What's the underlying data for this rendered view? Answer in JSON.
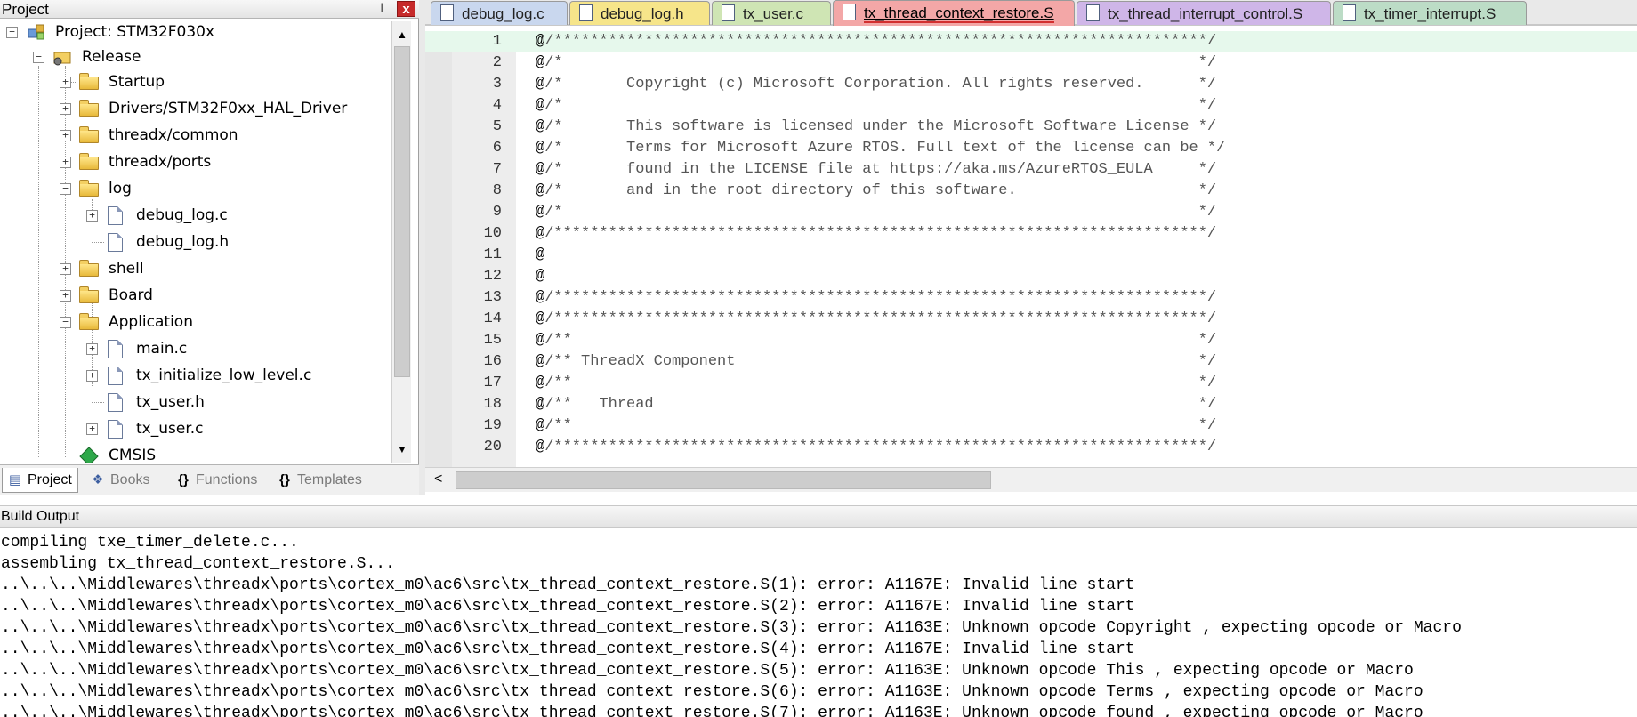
{
  "project_panel": {
    "title": "Project",
    "pin_icon": "pin-icon",
    "close_label": "x",
    "tree": [
      {
        "label": "Project: STM32F030x",
        "icon": "project-icon",
        "expander": "−"
      },
      {
        "label": "Release",
        "icon": "target-icon",
        "expander": "−"
      },
      {
        "label": "Startup",
        "icon": "folder-icon",
        "expander": "+"
      },
      {
        "label": "Drivers/STM32F0xx_HAL_Driver",
        "icon": "folder-icon",
        "expander": "+"
      },
      {
        "label": "threadx/common",
        "icon": "folder-icon",
        "expander": "+"
      },
      {
        "label": "threadx/ports",
        "icon": "folder-icon",
        "expander": "+"
      },
      {
        "label": "log",
        "icon": "open-folder-icon",
        "expander": "−"
      },
      {
        "label": "debug_log.c",
        "icon": "file-icon",
        "expander": "+"
      },
      {
        "label": "debug_log.h",
        "icon": "file-icon",
        "expander": ""
      },
      {
        "label": "shell",
        "icon": "folder-icon",
        "expander": "+"
      },
      {
        "label": "Board",
        "icon": "folder-icon",
        "expander": "+"
      },
      {
        "label": "Application",
        "icon": "open-folder-icon",
        "expander": "−"
      },
      {
        "label": "main.c",
        "icon": "file-icon",
        "expander": "+"
      },
      {
        "label": "tx_initialize_low_level.c",
        "icon": "file-icon",
        "expander": "+"
      },
      {
        "label": "tx_user.h",
        "icon": "file-icon",
        "expander": ""
      },
      {
        "label": "tx_user.c",
        "icon": "file-icon",
        "expander": "+"
      },
      {
        "label": "CMSIS",
        "icon": "cmsis-icon",
        "expander": ""
      }
    ],
    "tabs": [
      {
        "label": "Project",
        "icon": "project-tab-icon"
      },
      {
        "label": "Books",
        "icon": "books-icon"
      },
      {
        "label": "Functions",
        "icon": "functions-icon"
      },
      {
        "label": "Templates",
        "icon": "templates-icon"
      }
    ]
  },
  "editor": {
    "tabs": [
      {
        "label": "debug_log.c",
        "color": "#c9d7ee"
      },
      {
        "label": "debug_log.h",
        "color": "#f6e58a"
      },
      {
        "label": "tx_user.c",
        "color": "#cfe5b4"
      },
      {
        "label": "tx_thread_context_restore.S",
        "color": "#f3a7a7"
      },
      {
        "label": "tx_thread_interrupt_control.S",
        "color": "#cfb6e8"
      },
      {
        "label": "tx_timer_interrupt.S",
        "color": "#bcdcc6"
      }
    ],
    "lines": [
      {
        "num": "1",
        "text": "/************************************************************************/"
      },
      {
        "num": "2",
        "text": "/*                                                                      */"
      },
      {
        "num": "3",
        "text": "/*       Copyright (c) Microsoft Corporation. All rights reserved.      */"
      },
      {
        "num": "4",
        "text": "/*                                                                      */"
      },
      {
        "num": "5",
        "text": "/*       This software is licensed under the Microsoft Software License */"
      },
      {
        "num": "6",
        "text": "/*       Terms for Microsoft Azure RTOS. Full text of the license can be */"
      },
      {
        "num": "7",
        "text": "/*       found in the LICENSE file at https://aka.ms/AzureRTOS_EULA     */"
      },
      {
        "num": "8",
        "text": "/*       and in the root directory of this software.                    */"
      },
      {
        "num": "9",
        "text": "/*                                                                      */"
      },
      {
        "num": "10",
        "text": "/************************************************************************/"
      },
      {
        "num": "11",
        "text": ""
      },
      {
        "num": "12",
        "text": ""
      },
      {
        "num": "13",
        "text": "/************************************************************************/"
      },
      {
        "num": "14",
        "text": "/************************************************************************/"
      },
      {
        "num": "15",
        "text": "/**                                                                     */"
      },
      {
        "num": "16",
        "text": "/** ThreadX Component                                                   */"
      },
      {
        "num": "17",
        "text": "/**                                                                     */"
      },
      {
        "num": "18",
        "text": "/**   Thread                                                            */"
      },
      {
        "num": "19",
        "text": "/**                                                                     */"
      },
      {
        "num": "20",
        "text": "/************************************************************************/"
      }
    ],
    "line_prefix": "@",
    "scroll_left": "<"
  },
  "build_output": {
    "title": "Build Output",
    "lines": [
      "compiling txe_timer_delete.c...",
      "assembling tx_thread_context_restore.S...",
      "..\\..\\..\\Middlewares\\threadx\\ports\\cortex_m0\\ac6\\src\\tx_thread_context_restore.S(1): error: A1167E: Invalid line start",
      "..\\..\\..\\Middlewares\\threadx\\ports\\cortex_m0\\ac6\\src\\tx_thread_context_restore.S(2): error: A1167E: Invalid line start",
      "..\\..\\..\\Middlewares\\threadx\\ports\\cortex_m0\\ac6\\src\\tx_thread_context_restore.S(3): error: A1163E: Unknown opcode Copyright , expecting opcode or Macro",
      "..\\..\\..\\Middlewares\\threadx\\ports\\cortex_m0\\ac6\\src\\tx_thread_context_restore.S(4): error: A1167E: Invalid line start",
      "..\\..\\..\\Middlewares\\threadx\\ports\\cortex_m0\\ac6\\src\\tx_thread_context_restore.S(5): error: A1163E: Unknown opcode This , expecting opcode or Macro",
      "..\\..\\..\\Middlewares\\threadx\\ports\\cortex_m0\\ac6\\src\\tx_thread_context_restore.S(6): error: A1163E: Unknown opcode Terms , expecting opcode or Macro",
      "..\\..\\..\\Middlewares\\threadx\\ports\\cortex_m0\\ac6\\src\\tx_thread_context_restore.S(7): error: A1163E: Unknown opcode found , expecting opcode or Macro"
    ]
  }
}
